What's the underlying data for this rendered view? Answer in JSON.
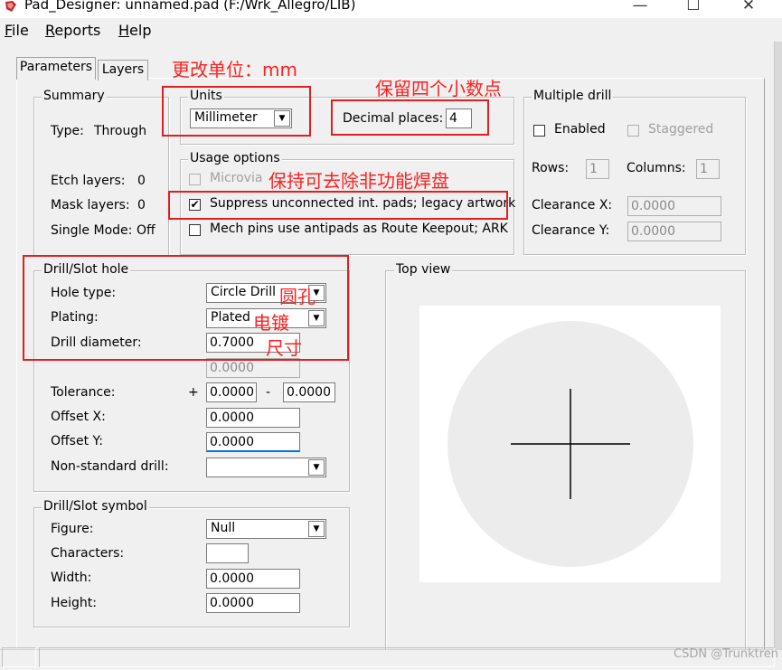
{
  "window": {
    "title": "Pad_Designer: unnamed.pad (F:/Wrk_Allegro/LIB)",
    "minimize_glyph": "—",
    "maximize_glyph": "☐",
    "close_glyph": "✕"
  },
  "menu": [
    {
      "key": "F",
      "rest": "ile"
    },
    {
      "key": "R",
      "rest": "eports"
    },
    {
      "key": "H",
      "rest": "elp"
    }
  ],
  "tabs": [
    "Parameters",
    "Layers"
  ],
  "summary": {
    "legend": "Summary",
    "type_label": "Type:",
    "type_value": "Through",
    "etch_label": "Etch layers:",
    "etch_value": "0",
    "mask_label": "Mask layers:",
    "mask_value": "0",
    "single_label": "Single Mode:",
    "single_value": "Off"
  },
  "units": {
    "legend": "Units",
    "selected": "Millimeter",
    "decimal_label": "Decimal places:",
    "decimal_value": "4"
  },
  "usage": {
    "legend": "Usage options",
    "microvia": "Microvia",
    "suppress": "Suppress unconnected int. pads; legacy artwork",
    "suppress_checked": "✔",
    "mech": "Mech pins use antipads as Route Keepout; ARK"
  },
  "multiple_drill": {
    "legend": "Multiple drill",
    "enabled": "Enabled",
    "staggered": "Staggered",
    "rows_label": "Rows:",
    "rows_value": "1",
    "columns_label": "Columns:",
    "columns_value": "1",
    "clearance_x_label": "Clearance X:",
    "clearance_x_value": "0.0000",
    "clearance_y_label": "Clearance Y:",
    "clearance_y_value": "0.0000"
  },
  "drill": {
    "legend": "Drill/Slot hole",
    "hole_type_label": "Hole type:",
    "hole_type_value": "Circle Drill",
    "plating_label": "Plating:",
    "plating_value": "Plated",
    "diameter_label": "Drill diameter:",
    "diameter_value": "0.7000",
    "second_value": "0.0000",
    "tolerance_label": "Tolerance:",
    "tol_plus": "+",
    "tol_plus_value": "0.0000",
    "tol_minus": "-",
    "tol_minus_value": "0.0000",
    "offset_x_label": "Offset X:",
    "offset_x_value": "0.0000",
    "offset_y_label": "Offset Y:",
    "offset_y_value": "0.0000",
    "nonstandard_label": "Non-standard drill:",
    "nonstandard_value": ""
  },
  "symbol": {
    "legend": "Drill/Slot symbol",
    "figure_label": "Figure:",
    "figure_value": "Null",
    "characters_label": "Characters:",
    "characters_value": "",
    "width_label": "Width:",
    "width_value": "0.0000",
    "height_label": "Height:",
    "height_value": "0.0000"
  },
  "top_view": {
    "legend": "Top view",
    "circle_color": "#ececec"
  },
  "annotations": {
    "units": "更改单位：mm",
    "decimals": "保留四个小数点",
    "suppress": "保持可去除非功能焊盘",
    "round_hole": "圆孔",
    "plating": "电镀",
    "size": "尺寸"
  },
  "watermark": "CSDN @Trunktren",
  "colors": {
    "annotation_red": "#ff2020",
    "window_bg": "#f0f0f0"
  }
}
